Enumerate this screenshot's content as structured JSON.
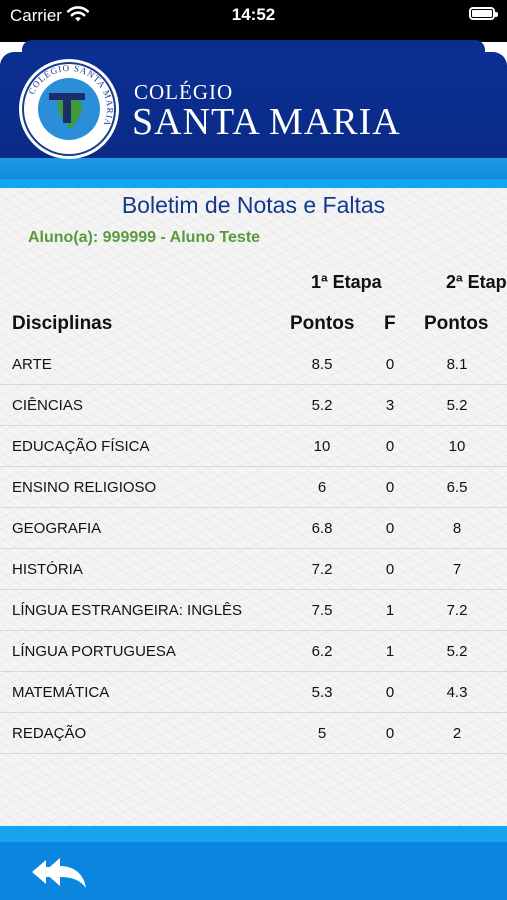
{
  "status": {
    "carrier": "Carrier",
    "time": "14:52"
  },
  "header": {
    "brand_small": "COLÉGIO",
    "brand_large": "SANTA MARIA",
    "logo_ring_text": "COLÉGIO SANTA MARIA"
  },
  "report": {
    "title": "Boletim de Notas e Faltas",
    "student": "Aluno(a): 999999 - Aluno Teste"
  },
  "table": {
    "etapas": [
      "1ª Etapa",
      "2ª Etap"
    ],
    "headers": {
      "disciplina": "Disciplinas",
      "pontos1": "Pontos",
      "faltas1": "F",
      "pontos2": "Pontos"
    },
    "rows": [
      {
        "name": "ARTE",
        "p1": "8.5",
        "f1": "0",
        "p2": "8.1"
      },
      {
        "name": "CIÊNCIAS",
        "p1": "5.2",
        "f1": "3",
        "p2": "5.2"
      },
      {
        "name": "EDUCAÇÃO FÍSICA",
        "p1": "10",
        "f1": "0",
        "p2": "10"
      },
      {
        "name": "ENSINO RELIGIOSO",
        "p1": "6",
        "f1": "0",
        "p2": "6.5"
      },
      {
        "name": "GEOGRAFIA",
        "p1": "6.8",
        "f1": "0",
        "p2": "8"
      },
      {
        "name": "HISTÓRIA",
        "p1": "7.2",
        "f1": "0",
        "p2": "7"
      },
      {
        "name": "LÍNGUA ESTRANGEIRA: INGLÊS",
        "p1": "7.5",
        "f1": "1",
        "p2": "7.2"
      },
      {
        "name": "LÍNGUA PORTUGUESA",
        "p1": "6.2",
        "f1": "1",
        "p2": "5.2"
      },
      {
        "name": "MATEMÁTICA",
        "p1": "5.3",
        "f1": "0",
        "p2": "4.3"
      },
      {
        "name": "REDAÇÃO",
        "p1": "5",
        "f1": "0",
        "p2": "2"
      }
    ]
  },
  "footer": {
    "back_icon": "back-arrows-icon"
  },
  "colors": {
    "header_blue": "#0b2f93",
    "stripe_blue": "#1a9be6",
    "title_blue": "#123a8c",
    "student_green": "#5a9a3c",
    "footer_blue": "#0a86de"
  }
}
